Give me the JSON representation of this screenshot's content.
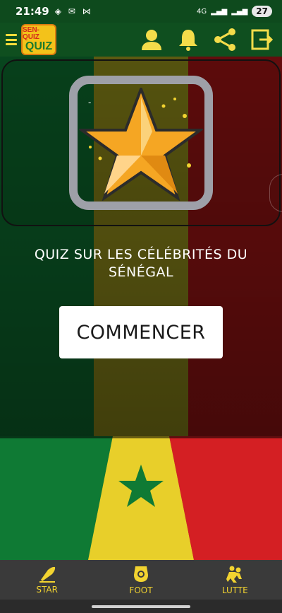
{
  "status": {
    "time": "21:49",
    "icons": [
      "location-icon",
      "mail-icon",
      "game-icon"
    ],
    "network": "4G",
    "battery": "27"
  },
  "appbar": {
    "logo_line1": "SEN-QUIZ",
    "logo_line2": "QUIZ",
    "actions": [
      "profile-icon",
      "bell-icon",
      "share-icon",
      "logout-icon"
    ]
  },
  "main": {
    "dash": "-",
    "title": "QUIZ SUR LES CÉLÉBRITÉS DU SÉNÉGAL",
    "start_label": "COMMENCER"
  },
  "bottomnav": {
    "items": [
      {
        "label": "STAR",
        "icon": "rocket-icon"
      },
      {
        "label": "FOOT",
        "icon": "football-icon"
      },
      {
        "label": "LUTTE",
        "icon": "wrestling-icon"
      }
    ]
  },
  "colors": {
    "green": "#00853f",
    "yellow": "#fdef42",
    "red": "#e31b23",
    "accent": "#f2d330"
  }
}
